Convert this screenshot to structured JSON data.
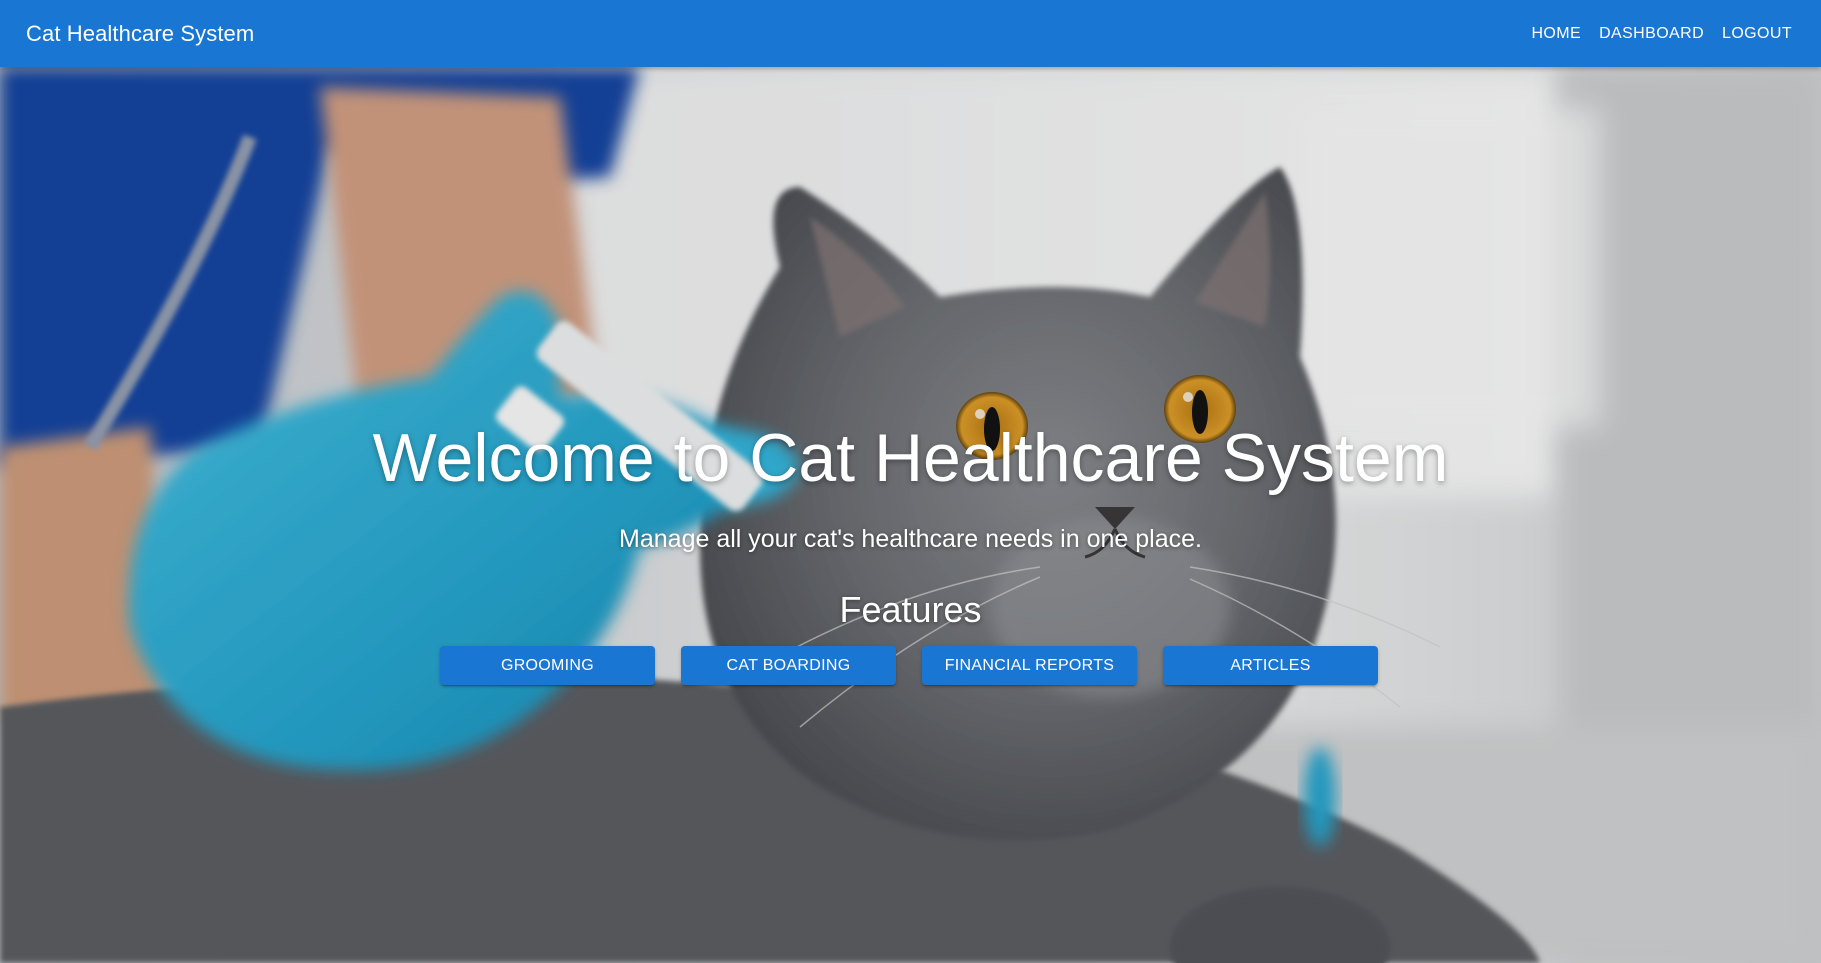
{
  "appbar": {
    "title": "Cat Healthcare System",
    "nav": [
      {
        "label": "HOME"
      },
      {
        "label": "DASHBOARD"
      },
      {
        "label": "LOGOUT"
      }
    ]
  },
  "hero": {
    "background_image": "photo-vet-gloved-hand-injecting-grey-cat",
    "title": "Welcome to Cat Healthcare System",
    "subtitle": "Manage all your cat's healthcare needs in one place.",
    "features_heading": "Features",
    "features": [
      {
        "label": "GROOMING"
      },
      {
        "label": "CAT BOARDING"
      },
      {
        "label": "FINANCIAL REPORTS"
      },
      {
        "label": "ARTICLES"
      }
    ]
  },
  "colors": {
    "primary": "#1976d2",
    "text_on_primary": "#ffffff"
  }
}
